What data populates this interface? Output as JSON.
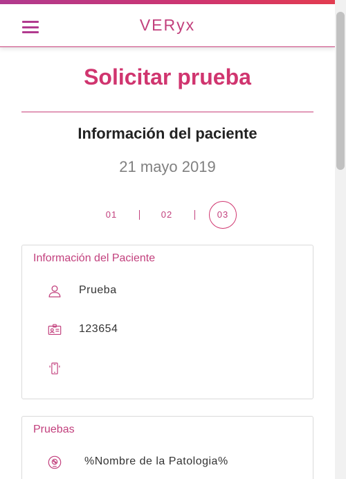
{
  "app": {
    "title": "VERyx"
  },
  "colors": {
    "accent": "#d0356f",
    "accent_dark": "#b13a8f",
    "muted": "#808080"
  },
  "page": {
    "title": "Solicitar prueba",
    "section_title": "Información del paciente",
    "date": "21 mayo 2019"
  },
  "stepper": {
    "steps": [
      {
        "label": "01",
        "active": false
      },
      {
        "label": "02",
        "active": false
      },
      {
        "label": "03",
        "active": true
      }
    ]
  },
  "patient_card": {
    "title": "Información del Paciente",
    "rows": [
      {
        "icon": "user-icon",
        "value": "Prueba"
      },
      {
        "icon": "id-card-icon",
        "value": "123654"
      },
      {
        "icon": "mobile-phone-icon",
        "value": ""
      }
    ]
  },
  "tests_card": {
    "title": "Pruebas",
    "rows": [
      {
        "icon": "pathology-icon",
        "value": "%Nombre de la Patologia%"
      }
    ]
  }
}
